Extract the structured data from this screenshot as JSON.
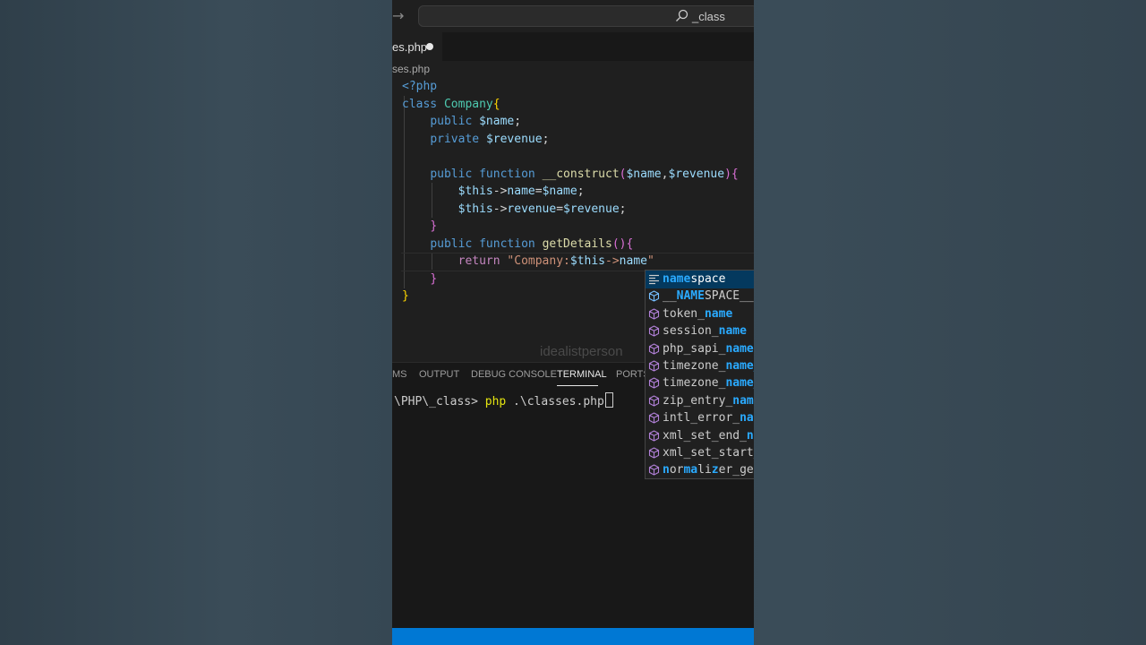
{
  "colors": {
    "accent": "#0078d4",
    "background": "#1f1f1f",
    "highlight_match": "#2aaaff"
  },
  "titlebar": {
    "nav_icon": "arrow-right-icon",
    "search_icon": "search-icon",
    "search_text": "_class"
  },
  "tab": {
    "label": "es.php",
    "modified_indicator": "dot"
  },
  "breadcrumb": "ses.php",
  "code": [
    [
      {
        "t": "<?php",
        "c": "kw"
      }
    ],
    [
      {
        "t": "class ",
        "c": "kw"
      },
      {
        "t": "Company",
        "c": "cls"
      },
      {
        "t": "{",
        "c": "br1"
      }
    ],
    [
      {
        "t": "    "
      },
      {
        "t": "public ",
        "c": "kw"
      },
      {
        "t": "$name",
        "c": "var"
      },
      {
        "t": ";",
        "c": "op"
      }
    ],
    [
      {
        "t": "    "
      },
      {
        "t": "private ",
        "c": "kw"
      },
      {
        "t": "$revenue",
        "c": "var"
      },
      {
        "t": ";",
        "c": "op"
      }
    ],
    [
      {
        "t": ""
      }
    ],
    [
      {
        "t": "    "
      },
      {
        "t": "public ",
        "c": "kw"
      },
      {
        "t": "function ",
        "c": "kw"
      },
      {
        "t": "__construct",
        "c": "fn"
      },
      {
        "t": "(",
        "c": "br2"
      },
      {
        "t": "$name",
        "c": "var"
      },
      {
        "t": ",",
        "c": "op"
      },
      {
        "t": "$revenue",
        "c": "var"
      },
      {
        "t": ")",
        "c": "br2"
      },
      {
        "t": "{",
        "c": "br2"
      }
    ],
    [
      {
        "t": "        "
      },
      {
        "t": "$this",
        "c": "var"
      },
      {
        "t": "->",
        "c": "op"
      },
      {
        "t": "name",
        "c": "var"
      },
      {
        "t": "=",
        "c": "op"
      },
      {
        "t": "$name",
        "c": "var"
      },
      {
        "t": ";",
        "c": "op"
      }
    ],
    [
      {
        "t": "        "
      },
      {
        "t": "$this",
        "c": "var"
      },
      {
        "t": "->",
        "c": "op"
      },
      {
        "t": "revenue",
        "c": "var"
      },
      {
        "t": "=",
        "c": "op"
      },
      {
        "t": "$revenue",
        "c": "var"
      },
      {
        "t": ";",
        "c": "op"
      }
    ],
    [
      {
        "t": "    "
      },
      {
        "t": "}",
        "c": "br2"
      }
    ],
    [
      {
        "t": "    "
      },
      {
        "t": "public ",
        "c": "kw"
      },
      {
        "t": "function ",
        "c": "kw"
      },
      {
        "t": "getDetails",
        "c": "fn"
      },
      {
        "t": "()",
        "c": "br2"
      },
      {
        "t": "{",
        "c": "br2"
      }
    ],
    [
      {
        "t": "        "
      },
      {
        "t": "return ",
        "c": "ret"
      },
      {
        "t": "\"Company:",
        "c": "str"
      },
      {
        "t": "$this",
        "c": "var"
      },
      {
        "t": "->",
        "c": "str"
      },
      {
        "t": "name",
        "c": "var"
      },
      {
        "t": "\"",
        "c": "str"
      }
    ],
    [
      {
        "t": "    "
      },
      {
        "t": "}",
        "c": "br2"
      }
    ],
    [
      {
        "t": "}",
        "c": "br1"
      }
    ]
  ],
  "watermark": "idealistperson",
  "panel": {
    "tabs": [
      {
        "label": "MS",
        "active": false
      },
      {
        "label": "OUTPUT",
        "active": false
      },
      {
        "label": "DEBUG CONSOLE",
        "active": false
      },
      {
        "label": "TERMINAL",
        "active": true
      },
      {
        "label": "PORTS",
        "active": false
      }
    ],
    "terminal_prompt": "\\PHP\\_class> ",
    "terminal_command": "php",
    "terminal_args": " .\\classes.php"
  },
  "suggestions": [
    {
      "parts": [
        {
          "t": "name",
          "h": true
        },
        {
          "t": "space",
          "h": false
        }
      ],
      "icon": "keyword",
      "selected": true
    },
    {
      "parts": [
        {
          "t": "__",
          "h": false
        },
        {
          "t": "NAME",
          "h": true
        },
        {
          "t": "SPACE__",
          "h": false
        }
      ],
      "icon": "constant",
      "selected": false
    },
    {
      "parts": [
        {
          "t": "token_",
          "h": false
        },
        {
          "t": "name",
          "h": true
        }
      ],
      "icon": "function",
      "selected": false
    },
    {
      "parts": [
        {
          "t": "session_",
          "h": false
        },
        {
          "t": "name",
          "h": true
        }
      ],
      "icon": "function",
      "selected": false
    },
    {
      "parts": [
        {
          "t": "php_sapi_",
          "h": false
        },
        {
          "t": "name",
          "h": true
        }
      ],
      "icon": "function",
      "selected": false
    },
    {
      "parts": [
        {
          "t": "timezone_",
          "h": false
        },
        {
          "t": "name_",
          "h": true
        }
      ],
      "icon": "function",
      "selected": false
    },
    {
      "parts": [
        {
          "t": "timezone_",
          "h": false
        },
        {
          "t": "name_",
          "h": true
        }
      ],
      "icon": "function",
      "selected": false
    },
    {
      "parts": [
        {
          "t": "zip_entry_",
          "h": false
        },
        {
          "t": "name",
          "h": true
        }
      ],
      "icon": "function",
      "selected": false
    },
    {
      "parts": [
        {
          "t": "intl_error_",
          "h": false
        },
        {
          "t": "nam",
          "h": true
        }
      ],
      "icon": "function",
      "selected": false
    },
    {
      "parts": [
        {
          "t": "xml_set_end_",
          "h": false
        },
        {
          "t": "na",
          "h": true
        }
      ],
      "icon": "function",
      "selected": false
    },
    {
      "parts": [
        {
          "t": "xml_set_start_",
          "h": false
        }
      ],
      "icon": "function",
      "selected": false
    },
    {
      "parts": [
        {
          "t": "n",
          "h": true
        },
        {
          "t": "or",
          "h": false
        },
        {
          "t": "ma",
          "h": true
        },
        {
          "t": "li",
          "h": false
        },
        {
          "t": "z",
          "h": true
        },
        {
          "t": "er_ge",
          "h": false
        }
      ],
      "icon": "function",
      "selected": false
    }
  ]
}
